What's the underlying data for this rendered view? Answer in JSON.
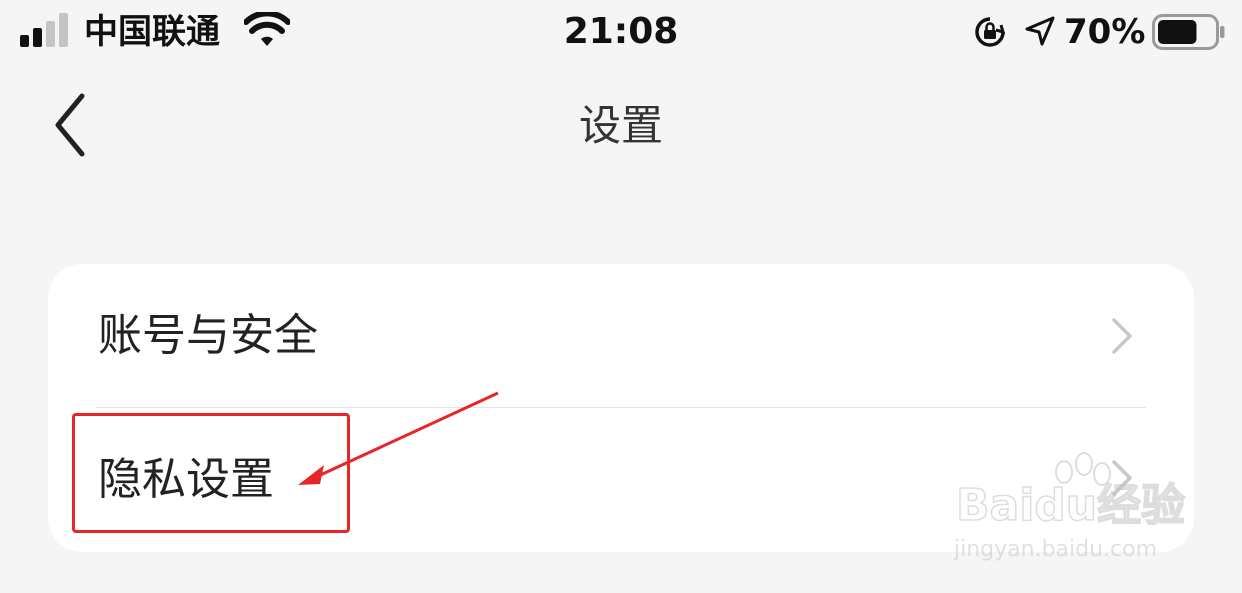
{
  "status_bar": {
    "carrier": "中国联通",
    "time": "21:08",
    "battery_percent": "70%",
    "battery_level": 0.7,
    "signal_bars_active": 2,
    "signal_bars_total": 4,
    "icons": [
      "signal-icon",
      "wifi-icon",
      "rotation-lock-icon",
      "location-arrow-icon",
      "battery-icon"
    ]
  },
  "nav": {
    "title": "设置",
    "back_icon": "chevron-left-icon"
  },
  "settings": {
    "items": [
      {
        "label": "账号与安全",
        "icon": "chevron-right-icon"
      },
      {
        "label": "隐私设置",
        "icon": "chevron-right-icon"
      }
    ]
  },
  "annotation": {
    "color": "#e8262a",
    "target": "隐私设置"
  },
  "watermark": {
    "brand": "Baidu经验",
    "url": "jingyan.baidu.com"
  },
  "colors": {
    "background": "#f5f5f5",
    "card": "#ffffff",
    "text": "#222222",
    "chevron": "#c8c8c8",
    "annotation": "#e8262a"
  }
}
